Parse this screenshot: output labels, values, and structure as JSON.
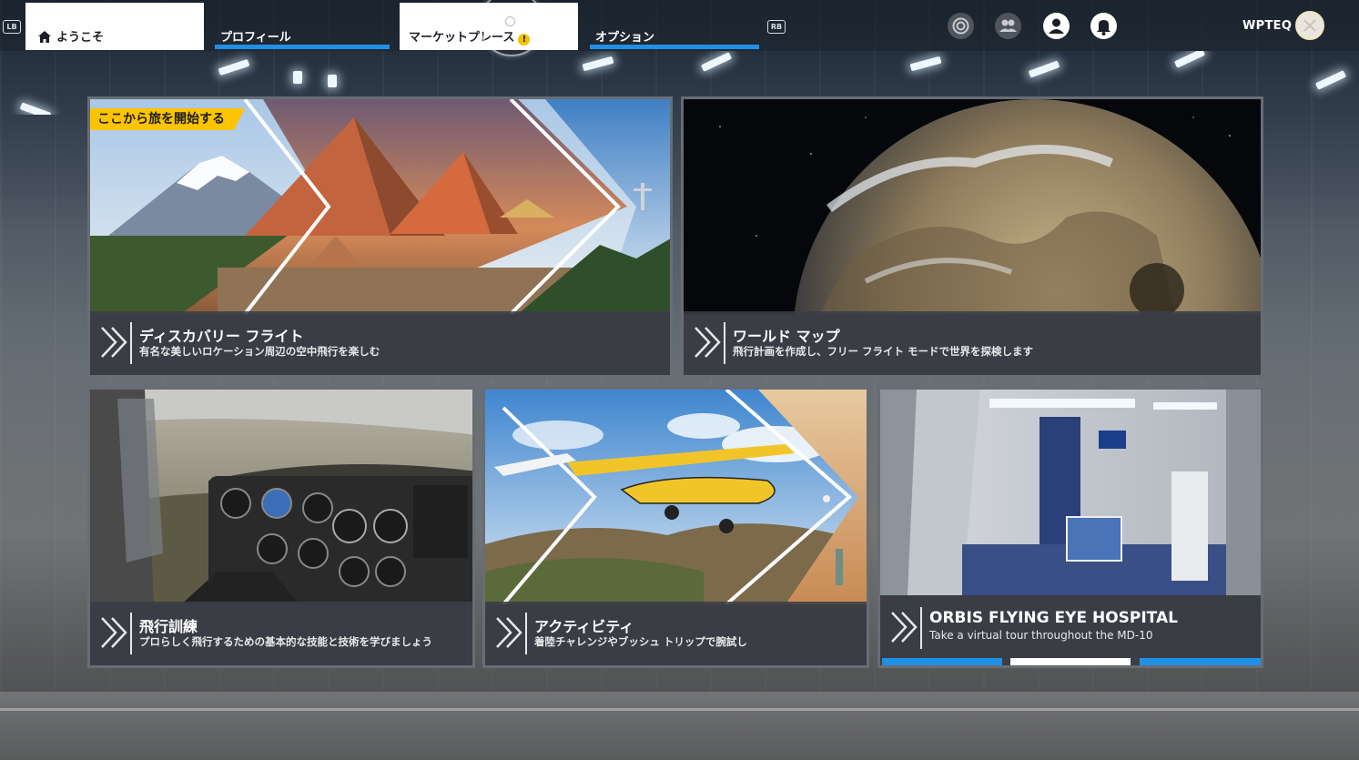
{
  "topbar": {
    "lb": "LB",
    "rb": "RB",
    "tabs": [
      {
        "label": "ようこそ"
      },
      {
        "label": "プロフィール"
      },
      {
        "label": "マーケットプレース"
      },
      {
        "label": "オプション"
      }
    ],
    "alert_glyph": "!",
    "username": "WPTEQ",
    "icons": [
      "achievements-icon",
      "friends-icon",
      "profile-icon",
      "notifications-icon"
    ]
  },
  "cards": {
    "discovery": {
      "banner": "ここから旅を開始する",
      "title": "ディスカバリー フライト",
      "desc": "有名な美しいロケーション周辺の空中飛行を楽しむ"
    },
    "worldmap": {
      "title": "ワールド マップ",
      "desc": "飛行計画を作成し、フリー フライト モードで世界を探検します"
    },
    "training": {
      "title": "飛行訓練",
      "desc": "プロらしく飛行するための基本的な技能と技術を学びましょう"
    },
    "activities": {
      "title": "アクティビティ",
      "desc": "着陸チャレンジやブッシュ トリップで腕試し"
    },
    "orbis": {
      "title": "ORBIS FLYING EYE HOSPITAL",
      "desc": "Take a virtual tour throughout the MD-10",
      "carousel_pages": 3,
      "carousel_active": 2
    }
  },
  "colors": {
    "accent": "#1e90e6",
    "banner": "#ffc400",
    "alert": "#f2c200"
  }
}
